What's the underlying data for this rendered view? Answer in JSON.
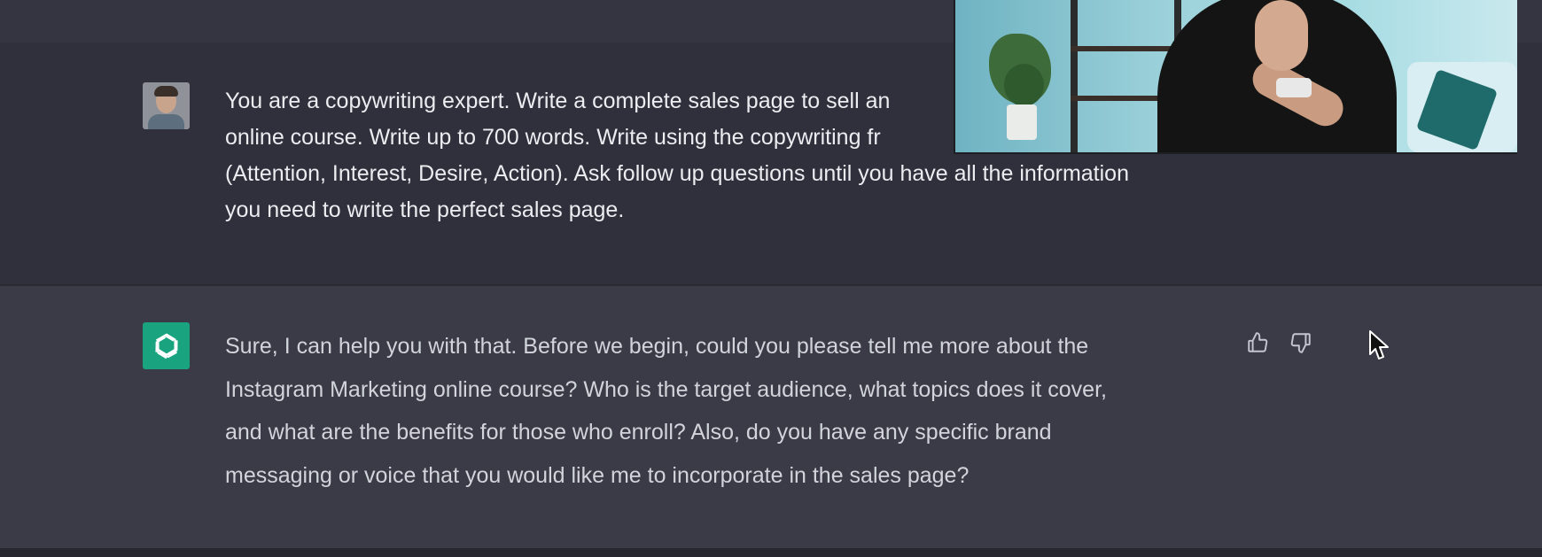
{
  "conversation": {
    "user": {
      "avatar_icon": "user-avatar-photo",
      "text": "You are a copywriting expert. Write a complete sales page to sell an online course. Write up to 700 words. Write using the copywriting fr (Attention, Interest, Desire, Action). Ask follow up questions until you have all the information you need to write the perfect sales page.",
      "lines": [
        "You are a copywriting expert. Write a complete sales page to sell an",
        "online course. Write up to 700 words. Write using the copywriting fr",
        "(Attention, Interest, Desire, Action). Ask follow up questions until you have all the information",
        "you need to write the perfect sales page."
      ]
    },
    "assistant": {
      "avatar_icon": "openai-logo-icon",
      "avatar_color": "#19a37e",
      "lines": [
        "Sure, I can help you with that. Before we begin, could you please tell me more about the",
        "Instagram Marketing online course? Who is the target audience, what topics does it cover,",
        "and what are the benefits for those who enroll? Also, do you have any specific brand",
        "messaging or voice that you would like me to incorporate in the sales page?"
      ],
      "feedback": {
        "thumbs_up_icon": "thumbs-up-icon",
        "thumbs_down_icon": "thumbs-down-icon"
      }
    }
  },
  "overlay": {
    "webcam_icon": "webcam-overlay"
  },
  "colors": {
    "page_bg": "#343541",
    "user_row_bg": "#2f303b",
    "assistant_row_bg": "#3a3b46",
    "text": "#ececf1"
  }
}
